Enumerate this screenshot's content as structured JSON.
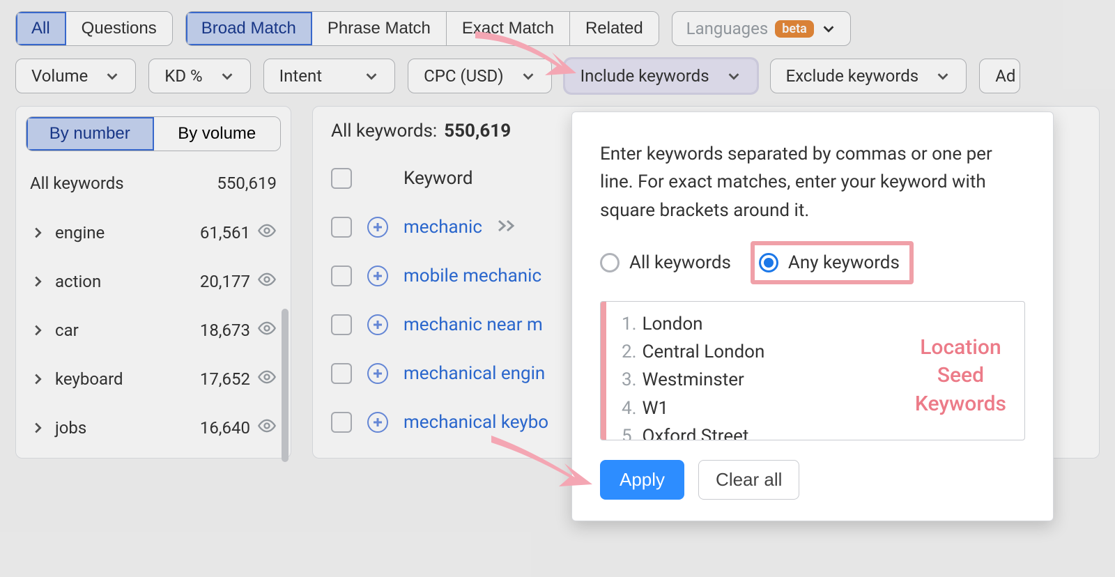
{
  "tabs": {
    "group1": [
      "All",
      "Questions"
    ],
    "group2": [
      "Broad Match",
      "Phrase Match",
      "Exact Match",
      "Related"
    ],
    "selected": 0,
    "selected2": 0,
    "languages_label": "Languages",
    "beta": "beta"
  },
  "filters": {
    "volume": "Volume",
    "kd": "KD %",
    "intent": "Intent",
    "cpc": "CPC (USD)",
    "include": "Include keywords",
    "exclude": "Exclude keywords",
    "ad": "Ad"
  },
  "sidebar": {
    "toggles": [
      "By number",
      "By volume"
    ],
    "toggle_selected": 0,
    "header_label": "All keywords",
    "header_count": "550,619",
    "groups": [
      {
        "name": "engine",
        "count": "61,561"
      },
      {
        "name": "action",
        "count": "20,177"
      },
      {
        "name": "car",
        "count": "18,673"
      },
      {
        "name": "keyboard",
        "count": "17,652"
      },
      {
        "name": "jobs",
        "count": "16,640"
      }
    ]
  },
  "content": {
    "all_kw_label": "All keywords:",
    "all_kw_count": "550,619",
    "col_keyword": "Keyword",
    "rows": [
      "mechanic",
      "mobile mechanic",
      "mechanic near m",
      "mechanical engin",
      "mechanical keybo"
    ]
  },
  "popover": {
    "instructions": "Enter keywords separated by commas or one per line. For exact matches, enter your keyword with square brackets around it.",
    "radio_all": "All keywords",
    "radio_any": "Any keywords",
    "selected": "any",
    "lines": [
      "London",
      "Central London",
      "Westminster",
      "W1",
      "Oxford Street"
    ],
    "location_label": "Location Seed Keywords",
    "apply": "Apply",
    "clear": "Clear all"
  }
}
